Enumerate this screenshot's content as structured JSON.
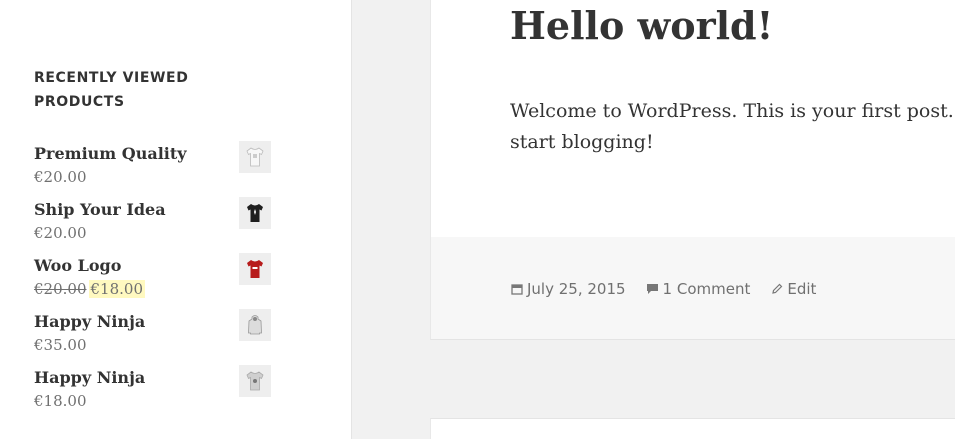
{
  "sidebar": {
    "widget_title_line1": "RECENTLY VIEWED",
    "widget_title_line2": "PRODUCTS",
    "products": [
      {
        "name": "Premium Quality",
        "price": "€20.00",
        "thumb_icon": "white-tshirt-icon",
        "thumb_color": "#f2f2f2"
      },
      {
        "name": "Ship Your Idea",
        "price": "€20.00",
        "thumb_icon": "black-tshirt-icon",
        "thumb_color": "#1f1f1f"
      },
      {
        "name": "Woo Logo",
        "old_price": "€20.00",
        "sale_price": "€18.00",
        "thumb_icon": "red-tshirt-icon",
        "thumb_color": "#b71c1c"
      },
      {
        "name": "Happy Ninja",
        "price": "€35.00",
        "thumb_icon": "grey-hoodie-icon",
        "thumb_color": "#dcdcdc"
      },
      {
        "name": "Happy Ninja",
        "price": "€18.00",
        "thumb_icon": "grey-tshirt-icon",
        "thumb_color": "#cfcfcf"
      }
    ]
  },
  "post": {
    "title": "Hello world!",
    "body_line1": "Welcome to WordPress. This is your first post. Ed",
    "body_line2": "start blogging!",
    "meta": {
      "date": "July 25, 2015",
      "comments": "1 Comment",
      "edit": "Edit"
    }
  }
}
